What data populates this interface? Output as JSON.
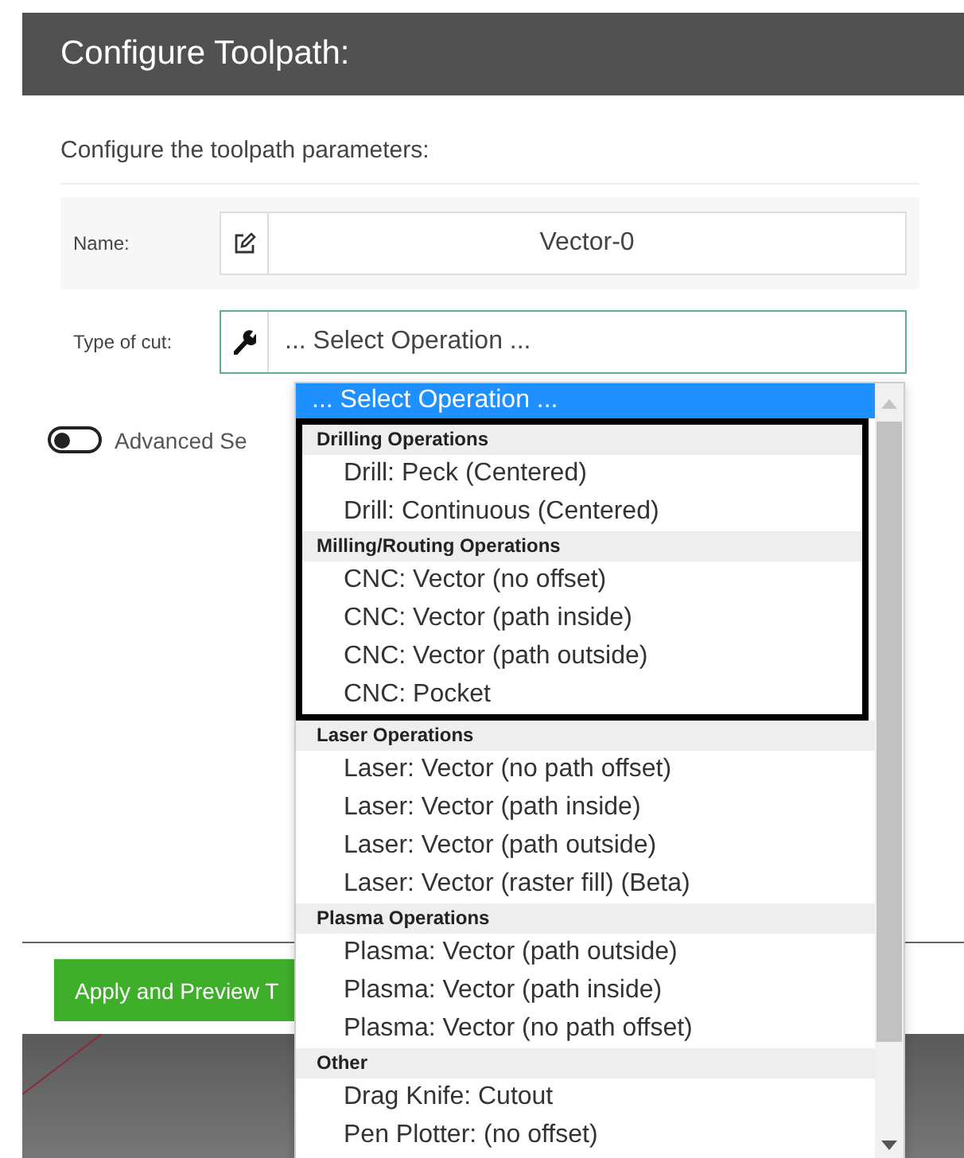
{
  "window": {
    "title": "Configure Toolpath:"
  },
  "subtitle": "Configure the toolpath parameters:",
  "fields": [
    {
      "kind": "text",
      "label": "Name:",
      "value": "Vector-0",
      "focused": false
    },
    {
      "kind": "select",
      "label": "Type of cut:",
      "value": "... Select Operation ...",
      "focused": true
    }
  ],
  "advanced_toggle": {
    "label": "Advanced Se",
    "on": false
  },
  "dropdown": {
    "first_option": {
      "label": "... Select Operation ...",
      "selected": true
    },
    "groups": [
      {
        "label": "Drilling Operations",
        "highlighted": true,
        "options": [
          {
            "label": "Drill: Peck (Centered)",
            "selected": false
          },
          {
            "label": "Drill: Continuous (Centered)",
            "selected": false
          }
        ]
      },
      {
        "label": "Milling/Routing Operations",
        "highlighted": true,
        "options": [
          {
            "label": "CNC: Vector (no offset)",
            "selected": false
          },
          {
            "label": "CNC: Vector (path inside)",
            "selected": false
          },
          {
            "label": "CNC: Vector (path outside)",
            "selected": false
          },
          {
            "label": "CNC: Pocket",
            "selected": false
          }
        ]
      },
      {
        "label": "Laser Operations",
        "highlighted": false,
        "options": [
          {
            "label": "Laser: Vector (no path offset)",
            "selected": false
          },
          {
            "label": "Laser: Vector (path inside)",
            "selected": false
          },
          {
            "label": "Laser: Vector (path outside)",
            "selected": false
          },
          {
            "label": "Laser: Vector (raster fill) (Beta)",
            "selected": false
          }
        ]
      },
      {
        "label": "Plasma Operations",
        "highlighted": false,
        "options": [
          {
            "label": "Plasma: Vector (path outside)",
            "selected": false
          },
          {
            "label": "Plasma: Vector (path inside)",
            "selected": false
          },
          {
            "label": "Plasma: Vector (no path offset)",
            "selected": false
          }
        ]
      },
      {
        "label": "Other",
        "highlighted": false,
        "options": [
          {
            "label": "Drag Knife: Cutout",
            "selected": false
          },
          {
            "label": "Pen Plotter: (no offset)",
            "selected": false
          }
        ]
      }
    ]
  },
  "apply_button": {
    "label": "Apply and Preview T"
  }
}
